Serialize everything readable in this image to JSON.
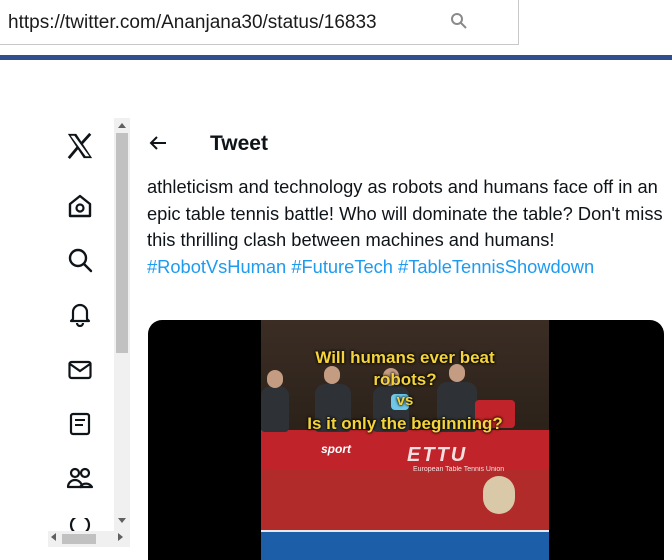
{
  "browser": {
    "url": "https://twitter.com/Ananjana30/status/16833"
  },
  "sidebar": {
    "items": [
      {
        "icon": "x-logo-icon"
      },
      {
        "icon": "home-icon"
      },
      {
        "icon": "search-icon"
      },
      {
        "icon": "notifications-icon"
      },
      {
        "icon": "messages-icon"
      },
      {
        "icon": "lists-icon"
      },
      {
        "icon": "communities-icon"
      },
      {
        "icon": "more-icon"
      }
    ]
  },
  "header": {
    "back_icon": "back-arrow-icon",
    "title": "Tweet"
  },
  "tweet": {
    "text_plain": "athleticism and technology as robots and humans face off in an epic table tennis battle! Who will dominate the table? Don't miss this thrilling clash between machines and humans!",
    "hashtags": [
      "#RobotVsHuman",
      "#FutureTech",
      "#TableTennisShowdown"
    ],
    "hashtag_color": "#1d9bf0"
  },
  "video": {
    "caption_lines": [
      "Will humans ever beat",
      "robots?",
      "vs",
      "Is it only the beginning?"
    ],
    "board_brand": "sport",
    "board_logo": "ETTU",
    "board_subtitle": "European Table Tennis Union",
    "caption_color": "#f5d43a"
  },
  "colors": {
    "accent_bar": "#2f4f8f",
    "text": "#0f1419"
  }
}
